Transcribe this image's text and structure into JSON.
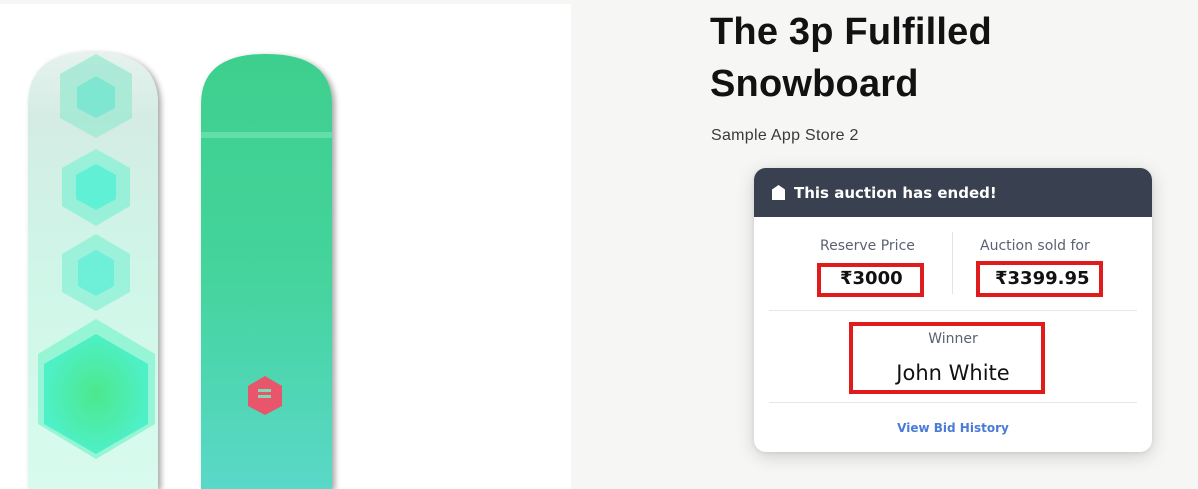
{
  "product": {
    "title": "The 3p Fulfilled Snowboard",
    "vendor": "Sample App Store 2",
    "image": {
      "description_icon": "snowboard-product-image",
      "colors": {
        "primary": "#3fd08f",
        "secondary": "#5fe3c9",
        "logo": "#e8566b"
      }
    }
  },
  "auction": {
    "status_icon": "tag-icon",
    "status_text": "This auction has ended!",
    "reserve_price_label": "Reserve Price",
    "reserve_price": "₹3000",
    "sold_for_label": "Auction sold for",
    "sold_for": "₹3399.95",
    "winner_label": "Winner",
    "winner_name": "John White",
    "history_link": "View Bid History",
    "colors": {
      "header_bg": "#394050",
      "link": "#4a7bd6",
      "highlight": "#e01b1b"
    }
  }
}
